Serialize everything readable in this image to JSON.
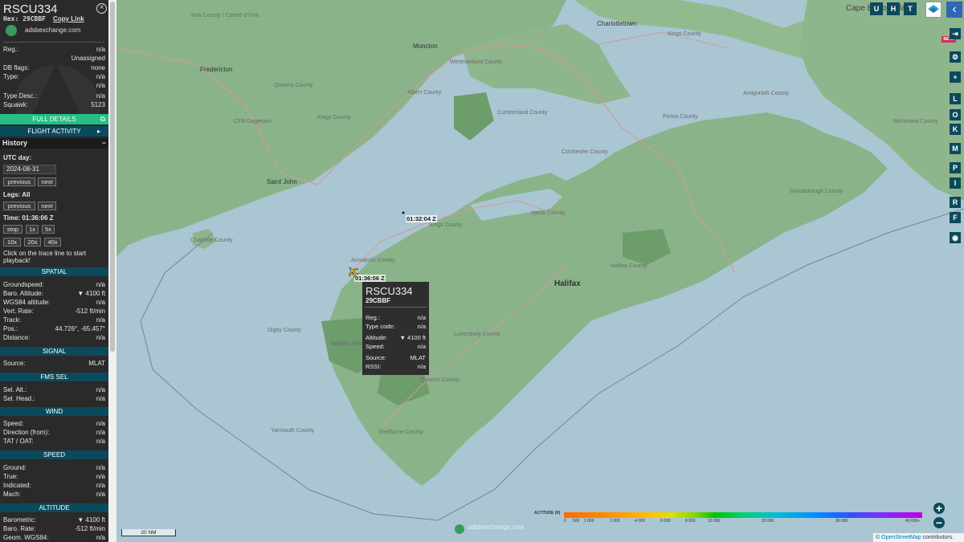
{
  "aircraft": {
    "callsign": "RSCU334",
    "hex_label": "Hex: 29CBBF",
    "copy_link": "Copy Link",
    "source_site": "adsbexchange.com"
  },
  "details": [
    {
      "k": "Reg.:",
      "v": "n/a"
    },
    {
      "k": "",
      "v": "Unassigned"
    },
    {
      "k": "DB flags:",
      "v": "none"
    },
    {
      "k": "Type:",
      "v": "n/a"
    },
    {
      "k": "",
      "v": "n/a"
    },
    {
      "k": "Type Desc.:",
      "v": "n/a"
    },
    {
      "k": "Squawk:",
      "v": "5123"
    }
  ],
  "buttons": {
    "full_details": "FULL DETAILS",
    "flight_activity": "FLIGHT ACTIVITY"
  },
  "history": {
    "title": "History",
    "collapse": "−",
    "utc_day_label": "UTC day:",
    "date": "2024-08-31",
    "previous": "previous",
    "next": "next",
    "legs_label": "Legs: All",
    "time_label": "Time: 01:36:06 Z",
    "stop": "stop",
    "speed_1x": "1x",
    "speed_5x": "5x",
    "speed_10x": "10x",
    "speed_20x": "20x",
    "speed_40x": "40x",
    "hint": "Click on the trace line to start playback!"
  },
  "sections": {
    "spatial": {
      "title": "SPATIAL",
      "rows": [
        {
          "k": "Groundspeed:",
          "v": "n/a"
        },
        {
          "k": "Baro. Altitude:",
          "v": "▼ 4100 ft"
        },
        {
          "k": "WGS84 altitude:",
          "v": "n/a"
        },
        {
          "k": "Vert. Rate:",
          "v": "-512 ft/min"
        },
        {
          "k": "Track:",
          "v": "n/a"
        },
        {
          "k": "Pos.:",
          "v": "44.726°, -65.457°"
        },
        {
          "k": "Distance:",
          "v": "n/a"
        }
      ]
    },
    "signal": {
      "title": "SIGNAL",
      "rows": [
        {
          "k": "Source:",
          "v": "MLAT"
        }
      ]
    },
    "fms": {
      "title": "FMS SEL",
      "rows": [
        {
          "k": "Sel. Alt.:",
          "v": "n/a"
        },
        {
          "k": "Sel. Head.:",
          "v": "n/a"
        }
      ]
    },
    "wind": {
      "title": "WIND",
      "rows": [
        {
          "k": "Speed:",
          "v": "n/a"
        },
        {
          "k": "Direction (from):",
          "v": "n/a"
        },
        {
          "k": "TAT / OAT:",
          "v": "n/a"
        }
      ]
    },
    "speed": {
      "title": "SPEED",
      "rows": [
        {
          "k": "Ground:",
          "v": "n/a"
        },
        {
          "k": "True:",
          "v": "n/a"
        },
        {
          "k": "Indicated:",
          "v": "n/a"
        },
        {
          "k": "Mach:",
          "v": "n/a"
        }
      ]
    },
    "altitude": {
      "title": "ALTITUDE",
      "rows": [
        {
          "k": "Barometric:",
          "v": "▼ 4100 ft"
        },
        {
          "k": "Baro. Rate:",
          "v": "-512 ft/min"
        },
        {
          "k": "Geom. WGS84:",
          "v": "n/a"
        }
      ]
    }
  },
  "map": {
    "places": [
      {
        "t": "York County / Comté d'York"
      },
      {
        "t": "Fredericton"
      },
      {
        "t": "Queens County"
      },
      {
        "t": "CFB Gagetown"
      },
      {
        "t": "Kings County"
      },
      {
        "t": "Saint John"
      },
      {
        "t": "Charlotte County"
      },
      {
        "t": "Moncton"
      },
      {
        "t": "Westmorland County"
      },
      {
        "t": "Albert County"
      },
      {
        "t": "Charlottetown"
      },
      {
        "t": "Kings County"
      },
      {
        "t": "Cumberland County"
      },
      {
        "t": "Colchester County"
      },
      {
        "t": "Pictou County"
      },
      {
        "t": "Antigonish County"
      },
      {
        "t": "Richmond County"
      },
      {
        "t": "Guysborough County"
      },
      {
        "t": "Hants County"
      },
      {
        "t": "Kings County"
      },
      {
        "t": "Halifax County"
      },
      {
        "t": "Halifax"
      },
      {
        "t": "Annapolis County"
      },
      {
        "t": "Digby County"
      },
      {
        "t": "Lunenburg County"
      },
      {
        "t": "Tobeatic Wilderness Area"
      },
      {
        "t": "Queens County"
      },
      {
        "t": "Yarmouth County"
      },
      {
        "t": "Shelburne County"
      },
      {
        "t": "Cape Breton Island"
      }
    ],
    "ts1": "01:32:04 Z",
    "ts2": "01:36:06 Z",
    "scale": "20 NM",
    "watermark": "adsbexchange.com",
    "attribution_prefix": "©",
    "attribution_link": "OpenStreetMap",
    "attribution_suffix": "contributors."
  },
  "popup": {
    "callsign": "RSCU334",
    "hex": "29CBBF",
    "rows": [
      {
        "k": "Reg.:",
        "v": "n/a"
      },
      {
        "k": "Type code:",
        "v": "n/a"
      },
      {
        "k": "Altitude:",
        "v": "▼ 4100 ft"
      },
      {
        "k": "Speed:",
        "v": "n/a"
      },
      {
        "k": "Source:",
        "v": "MLAT"
      },
      {
        "k": "RSSI:",
        "v": "n/a"
      }
    ]
  },
  "top_controls": [
    "U",
    "H",
    "T"
  ],
  "side_controls": [
    "L",
    "O",
    "K",
    "M",
    "P",
    "I",
    "R",
    "F"
  ],
  "beta_badge": "BETA",
  "altitude_legend": {
    "label": "ALTITUDE (ft)",
    "ticks": [
      "0",
      "500",
      "1 000",
      "2 000",
      "4 000",
      "6 000",
      "8 000",
      "10 000",
      "20 000",
      "30 000",
      "40 000+"
    ]
  },
  "zoom": {
    "in": "+",
    "out": "−"
  },
  "colors": {
    "teal": "#0b4a5c",
    "green": "#24c083",
    "aircraft": "#f2c200",
    "trace": "#e03030"
  }
}
